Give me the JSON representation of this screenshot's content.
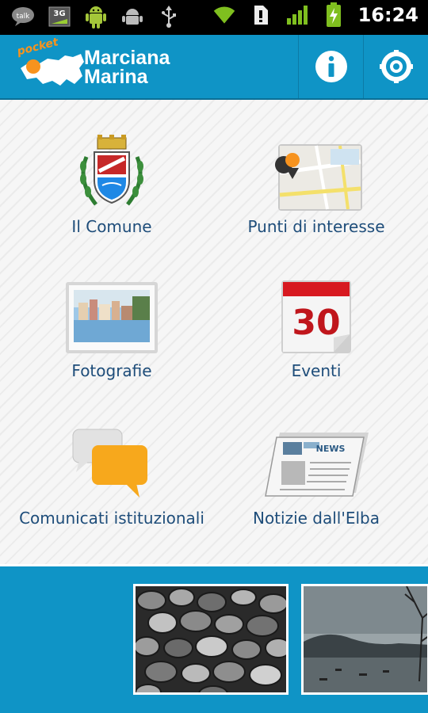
{
  "status_bar": {
    "time": "16:24",
    "left_icons": [
      "talk-icon",
      "3g-icon",
      "android-icon",
      "debug-icon",
      "usb-icon"
    ],
    "right_icons": [
      "wifi-icon",
      "sim-icon",
      "signal-icon",
      "battery-icon"
    ],
    "talk_text": "talk",
    "threeg_text": "3G"
  },
  "app_bar": {
    "logo_pocket": "pocket",
    "logo_line1": "Marciana",
    "logo_line2": "Marina",
    "actions": [
      "info-icon",
      "settings-icon"
    ],
    "color": "#0f94c6"
  },
  "menu": [
    {
      "label": "Il Comune",
      "icon": "coat-of-arms-icon"
    },
    {
      "label": "Punti di interesse",
      "icon": "map-pin-icon"
    },
    {
      "label": "Fotografie",
      "icon": "photo-icon"
    },
    {
      "label": "Eventi",
      "icon": "calendar-icon",
      "day": "30"
    },
    {
      "label": "Comunicati istituzionali",
      "icon": "chat-bubbles-icon"
    },
    {
      "label": "Notizie dall'Elba",
      "icon": "newspaper-icon",
      "news_text": "NEWS"
    }
  ],
  "gallery": {
    "photos": [
      "pebbles-photo",
      "harbor-photo"
    ]
  }
}
